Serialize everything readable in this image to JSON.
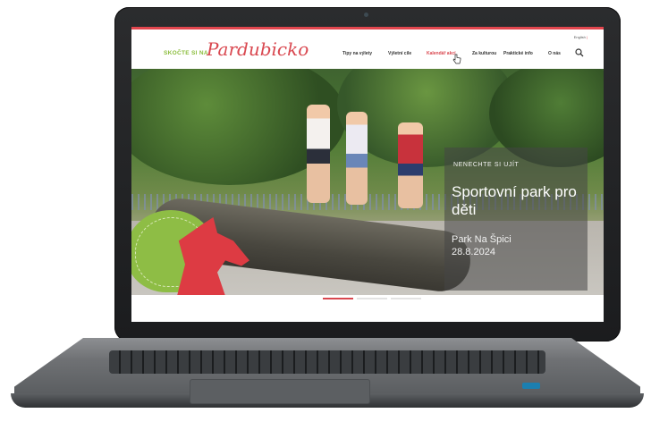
{
  "site": {
    "lang": "English",
    "lang_marker": "|",
    "brand_left": "SKOČTE SI NA",
    "brand_script": "Pardubicko"
  },
  "nav": {
    "items": [
      {
        "label": "Tipy na výlety",
        "active": false
      },
      {
        "label": "Výletní cíle",
        "active": false
      },
      {
        "label": "Kalendář akcí",
        "active": true
      },
      {
        "label": "Za kulturou",
        "active": false
      },
      {
        "label": "Praktické info",
        "active": false
      },
      {
        "label": "O nás",
        "active": false
      }
    ]
  },
  "hero": {
    "kicker": "NENECHTE SI UJÍT",
    "title": "Sportovní park pro děti",
    "subtitle": "Park Na Špici",
    "date": "28.8.2024",
    "slide_count": 3,
    "active_slide": 1
  },
  "colors": {
    "accent": "#d9474f",
    "green": "#8bbd3c",
    "nav_text": "#333333"
  },
  "icons": {
    "search": "search-icon",
    "cursor": "hand-pointer-icon"
  }
}
